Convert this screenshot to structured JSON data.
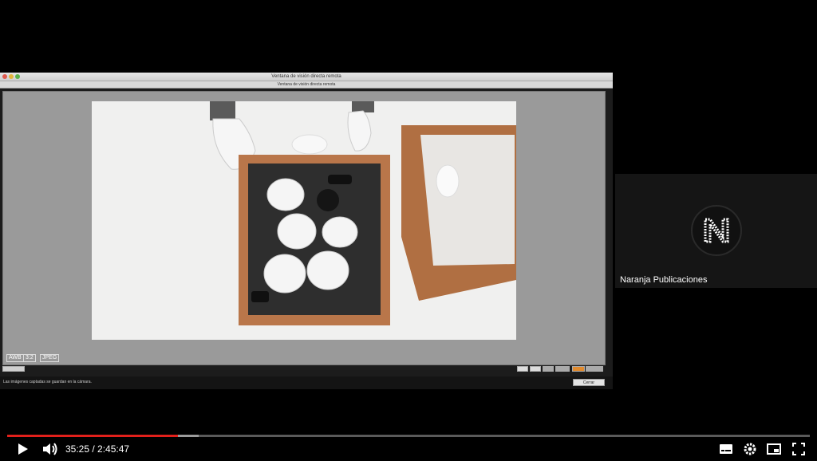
{
  "window": {
    "title": "Ventana de visión directa remota",
    "subtitle": "Ventana de visión directa remota",
    "overlay_labels": [
      "AWB",
      "3:2",
      "JPEG"
    ],
    "status_text": "Las imágenes captadas se guardan en la cámara.",
    "close_label": "Cerrar"
  },
  "channel": {
    "name": "Naranja Publicaciones",
    "avatar_letter": "N"
  },
  "player": {
    "time": "35:25 / 2:45:47",
    "progress_fraction": 0.213,
    "buffered_fraction": 0.239,
    "play_icon": "play-icon",
    "volume_icon": "volume-icon",
    "subtitles_icon": "subtitles-icon",
    "settings_icon": "settings-icon",
    "miniplayer_icon": "miniplayer-icon",
    "fullscreen_icon": "fullscreen-icon",
    "accent": "#e2201b"
  }
}
